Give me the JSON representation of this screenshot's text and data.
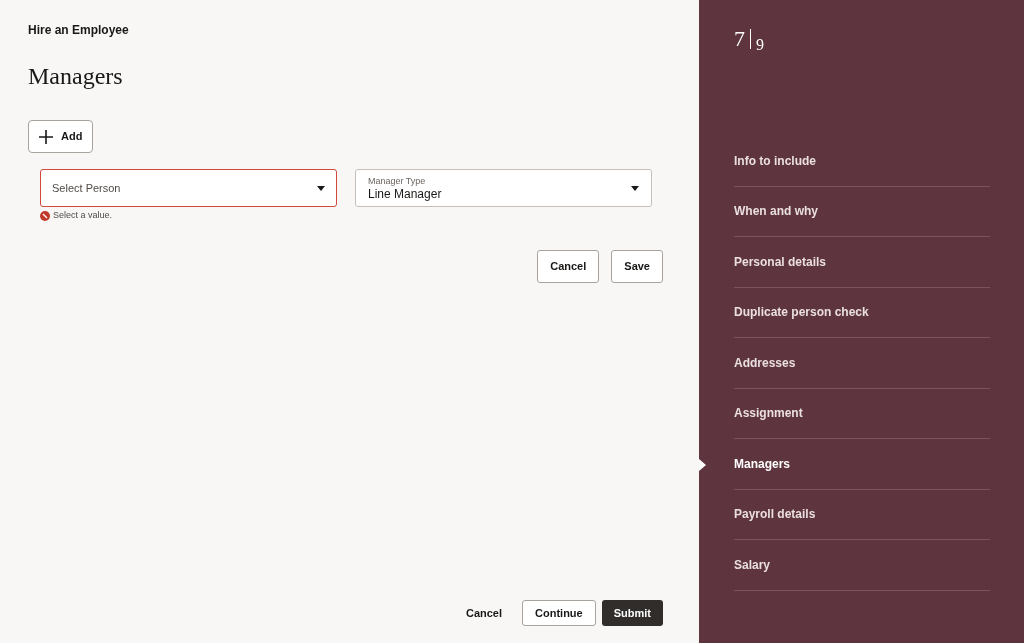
{
  "breadcrumb": "Hire an Employee",
  "title": "Managers",
  "add_button": "Add",
  "person_field": {
    "placeholder": "Select Person",
    "error": "Select a value."
  },
  "manager_type_field": {
    "label": "Manager Type",
    "value": "Line Manager"
  },
  "form_buttons": [
    "Cancel",
    "Save"
  ],
  "footer": {
    "cancel": "Cancel",
    "continue": "Continue",
    "submit": "Submit"
  },
  "progress": {
    "current": "7",
    "total": "9"
  },
  "steps": [
    {
      "label": "Info to include",
      "selected": false
    },
    {
      "label": "When and why",
      "selected": false
    },
    {
      "label": "Personal details",
      "selected": false
    },
    {
      "label": "Duplicate person check",
      "selected": false
    },
    {
      "label": "Addresses",
      "selected": false
    },
    {
      "label": "Assignment",
      "selected": false
    },
    {
      "label": "Managers",
      "selected": true
    },
    {
      "label": "Payroll details",
      "selected": false
    },
    {
      "label": "Salary",
      "selected": false
    }
  ]
}
